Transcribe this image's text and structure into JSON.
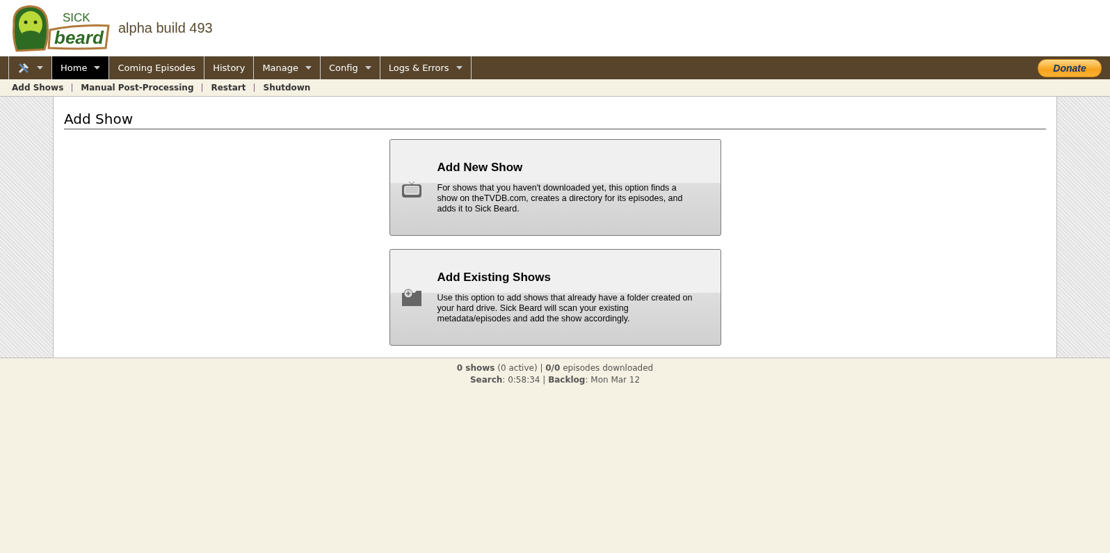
{
  "logo": {
    "line_1": "SICK",
    "line_2": "beard"
  },
  "build": "alpha build 493",
  "nav": [
    {
      "kind": "icon",
      "selected": false,
      "has_menu": true
    },
    {
      "kind": "text",
      "label": "Home",
      "selected": true,
      "has_menu": true
    },
    {
      "kind": "text",
      "label": "Coming Episodes",
      "selected": false,
      "has_menu": false
    },
    {
      "kind": "text",
      "label": "History",
      "selected": false,
      "has_menu": false
    },
    {
      "kind": "text",
      "label": "Manage",
      "selected": false,
      "has_menu": true
    },
    {
      "kind": "text",
      "label": "Config",
      "selected": false,
      "has_menu": true
    },
    {
      "kind": "text",
      "label": "Logs & Errors",
      "selected": false,
      "has_menu": true
    }
  ],
  "donate": "Donate",
  "subnav": [
    "Add Shows",
    "Manual Post-Processing",
    "Restart",
    "Shutdown"
  ],
  "page_title": "Add Show",
  "options": [
    {
      "kind": "tv",
      "title": "Add New Show",
      "description": "For shows that you haven't downloaded yet, this option finds a show on theTVDB.com, creates a directory for its episodes, and adds it to Sick Beard."
    },
    {
      "kind": "folder",
      "title": "Add Existing Shows",
      "description": "Use this option to add shows that already have a folder created on your hard drive. Sick Beard will scan your existing metadata/episodes and add the show accordingly."
    }
  ],
  "footer": [
    "**0 shows** (0 active) | **0/0** episodes downloaded",
    "**Search**: 0:58:34 | **Backlog**: Mon Mar 12"
  ]
}
